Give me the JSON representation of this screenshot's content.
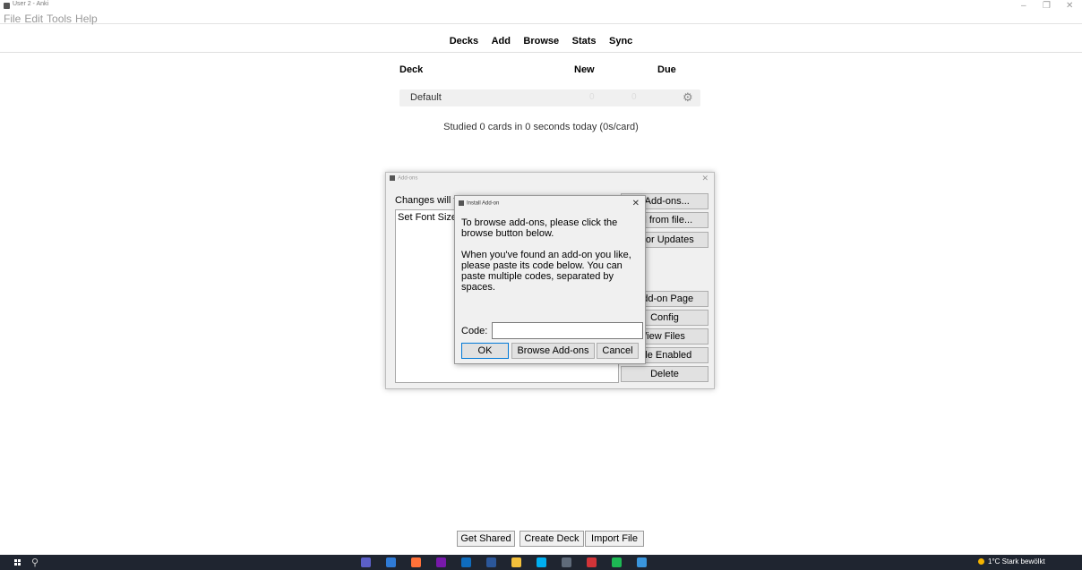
{
  "window": {
    "title": "User 2 - Anki",
    "minimize": "–",
    "maximize": "❐",
    "close": "✕"
  },
  "menubar": [
    "File",
    "Edit",
    "Tools",
    "Help"
  ],
  "toolbar": [
    "Decks",
    "Add",
    "Browse",
    "Stats",
    "Sync"
  ],
  "deck_table": {
    "headers": {
      "deck": "Deck",
      "new": "New",
      "due": "Due"
    },
    "rows": [
      {
        "name": "Default",
        "new": "0",
        "due": "0"
      }
    ],
    "gear_icon": "gear-icon"
  },
  "studied": "Studied 0 cards in 0 seconds today (0s/card)",
  "addons_dialog": {
    "title": "Add-ons",
    "changes_text": "Changes will t",
    "list_items": [
      "Set Font Size"
    ],
    "buttons": {
      "get_addons": ": Add-ons...",
      "install_from_file": "all from file...",
      "check_updates": "k for Updates",
      "addon_page": "Add-on Page",
      "config": "Config",
      "view_files": "/iew Files",
      "toggle_enabled": "jgle Enabled",
      "delete": "Delete"
    }
  },
  "install_dialog": {
    "title": "Install Add-on",
    "para1": "To browse add-ons, please click the browse button below.",
    "para2": "When you've found an add-on you like, please paste its code below. You can paste multiple codes, separated by spaces.",
    "code_label": "Code:",
    "code_value": "",
    "ok": "OK",
    "browse": "Browse Add-ons",
    "cancel": "Cancel"
  },
  "bottom_buttons": [
    "Get Shared",
    "Create Deck",
    "Import File"
  ],
  "taskbar": {
    "weather": "1°C  Stark bewölkt",
    "apps": [
      {
        "name": "teams-icon",
        "color": "#5b5fc7"
      },
      {
        "name": "todo-icon",
        "color": "#2f7bd6"
      },
      {
        "name": "firefox-icon",
        "color": "#ff7139"
      },
      {
        "name": "onenote-icon",
        "color": "#7719aa"
      },
      {
        "name": "outlook-icon",
        "color": "#0f6cbd"
      },
      {
        "name": "word-icon",
        "color": "#2b579a"
      },
      {
        "name": "file-explorer-icon",
        "color": "#f3c03c"
      },
      {
        "name": "skype-icon",
        "color": "#00aff0"
      },
      {
        "name": "anki-icon",
        "color": "#5f6b7a"
      },
      {
        "name": "app-red-icon",
        "color": "#d13438"
      },
      {
        "name": "spotify-icon",
        "color": "#1db954"
      },
      {
        "name": "photos-icon",
        "color": "#3a96dd"
      }
    ]
  }
}
